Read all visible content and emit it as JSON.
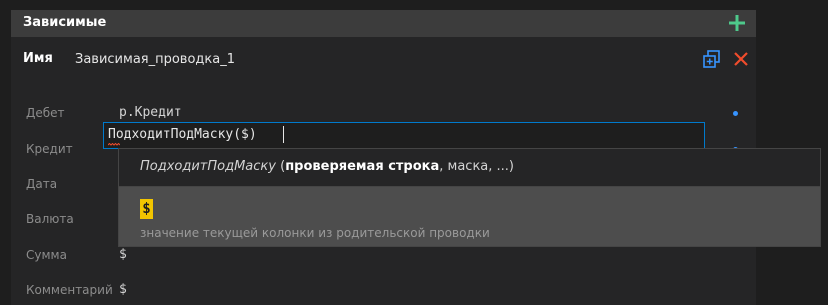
{
  "panel": {
    "title": "Зависимые",
    "add_icon": "plus-icon",
    "accent_add": "#4ec98b",
    "accent_copy": "#3794ff",
    "accent_close": "#f14c2c"
  },
  "entry": {
    "name_label": "Имя",
    "name_value": "Зависимая_проводка_1",
    "copy_icon": "duplicate-icon",
    "close_icon": "close-icon"
  },
  "fields": [
    {
      "label": "Дебет",
      "value": "р.Кредит"
    },
    {
      "label": "Кредит",
      "value": "ПодходитПодМаску($)"
    },
    {
      "label": "Дата",
      "value": "$"
    },
    {
      "label": "Валюта",
      "value": "$"
    },
    {
      "label": "Сумма",
      "value": "$"
    },
    {
      "label": "Комментарий",
      "value": "$"
    }
  ],
  "autocomplete": {
    "function_name": "ПодходитПодМаску",
    "open_paren": " (",
    "active_param": "проверяемая строка",
    "rest_params": ", маска, ...)",
    "suggestion_symbol": "$",
    "suggestion_description": "значение текущей колонки из родительской проводки"
  }
}
